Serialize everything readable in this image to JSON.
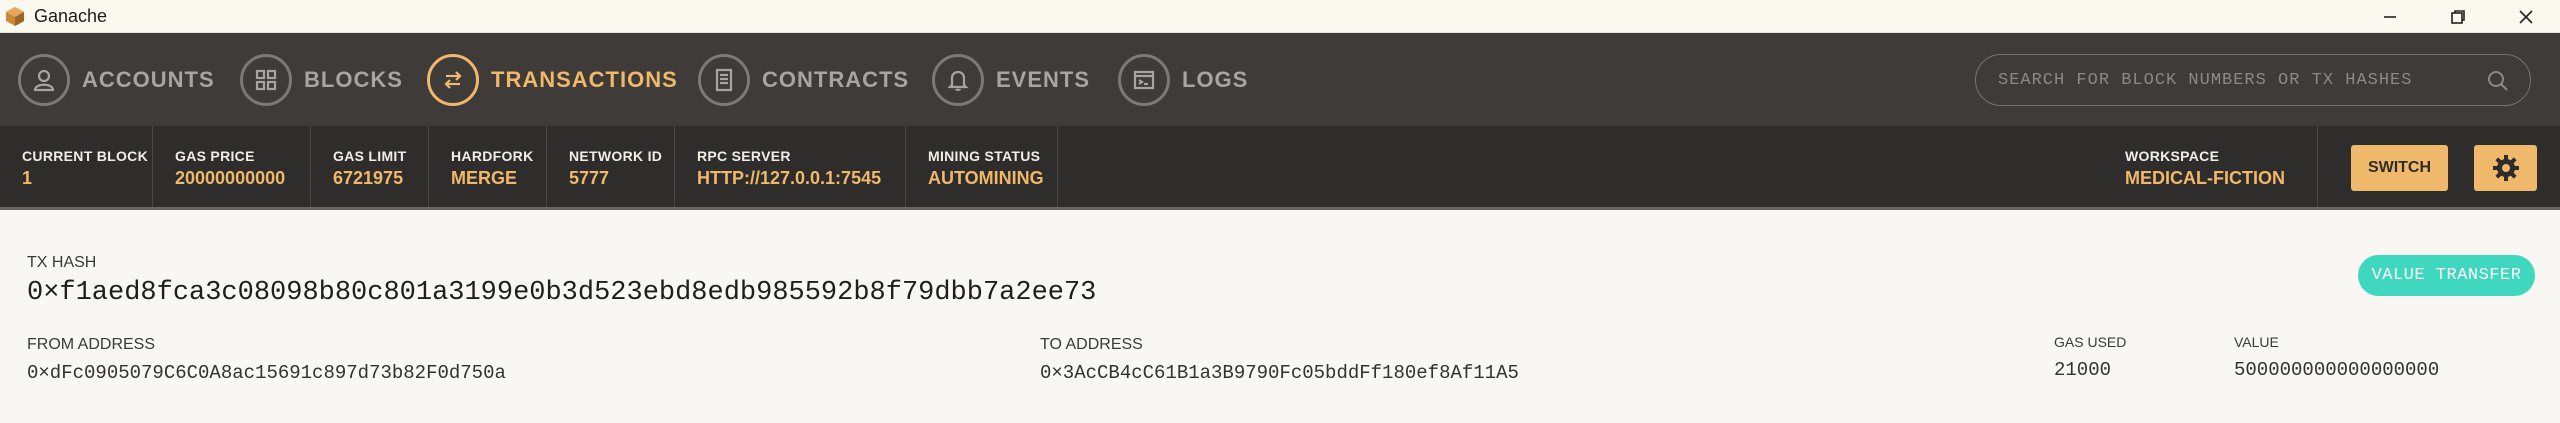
{
  "window": {
    "title": "Ganache",
    "icons": [
      "ganache-logo-icon",
      "minimize-icon",
      "restore-icon",
      "close-icon"
    ]
  },
  "nav": {
    "items": [
      {
        "label": "ACCOUNTS",
        "icon": "account-icon",
        "active": false
      },
      {
        "label": "BLOCKS",
        "icon": "grid-icon",
        "active": false
      },
      {
        "label": "TRANSACTIONS",
        "icon": "swap-arrows-icon",
        "active": true
      },
      {
        "label": "CONTRACTS",
        "icon": "document-icon",
        "active": false
      },
      {
        "label": "EVENTS",
        "icon": "bell-icon",
        "active": false
      },
      {
        "label": "LOGS",
        "icon": "terminal-icon",
        "active": false
      }
    ],
    "search_placeholder": "SEARCH FOR BLOCK NUMBERS OR TX HASHES"
  },
  "status": {
    "current_block": {
      "label": "CURRENT BLOCK",
      "value": "1"
    },
    "gas_price": {
      "label": "GAS PRICE",
      "value": "20000000000"
    },
    "gas_limit": {
      "label": "GAS LIMIT",
      "value": "6721975"
    },
    "hardfork": {
      "label": "HARDFORK",
      "value": "MERGE"
    },
    "network_id": {
      "label": "NETWORK ID",
      "value": "5777"
    },
    "rpc_server": {
      "label": "RPC SERVER",
      "value": "HTTP://127.0.0.1:7545"
    },
    "mining_status": {
      "label": "MINING STATUS",
      "value": "AUTOMINING"
    },
    "workspace": {
      "label": "WORKSPACE",
      "value": "MEDICAL-FICTION"
    },
    "switch_label": "SWITCH"
  },
  "transaction": {
    "tx_hash_label": "TX HASH",
    "tx_hash": "0×f1aed8fca3c08098b80c801a3199e0b3d523ebd8edb985592b8f79dbb7a2ee73",
    "type_badge": "VALUE TRANSFER",
    "from_label": "FROM ADDRESS",
    "from": "0×dFc0905079C6C0A8ac15691c897d73b82F0d750a",
    "to_label": "TO ADDRESS",
    "to": "0×3AcCB4cC61B1a3B9790Fc05bddFf180ef8Af11A5",
    "gas_used_label": "GAS USED",
    "gas_used": "21000",
    "value_label": "VALUE",
    "value": "500000000000000000"
  },
  "colors": {
    "accent": "#f0b86b",
    "nav_bg": "#3e3b38",
    "status_bg": "#2f2d2b",
    "badge": "#3fd7be",
    "content_bg": "#f8f7f3"
  }
}
